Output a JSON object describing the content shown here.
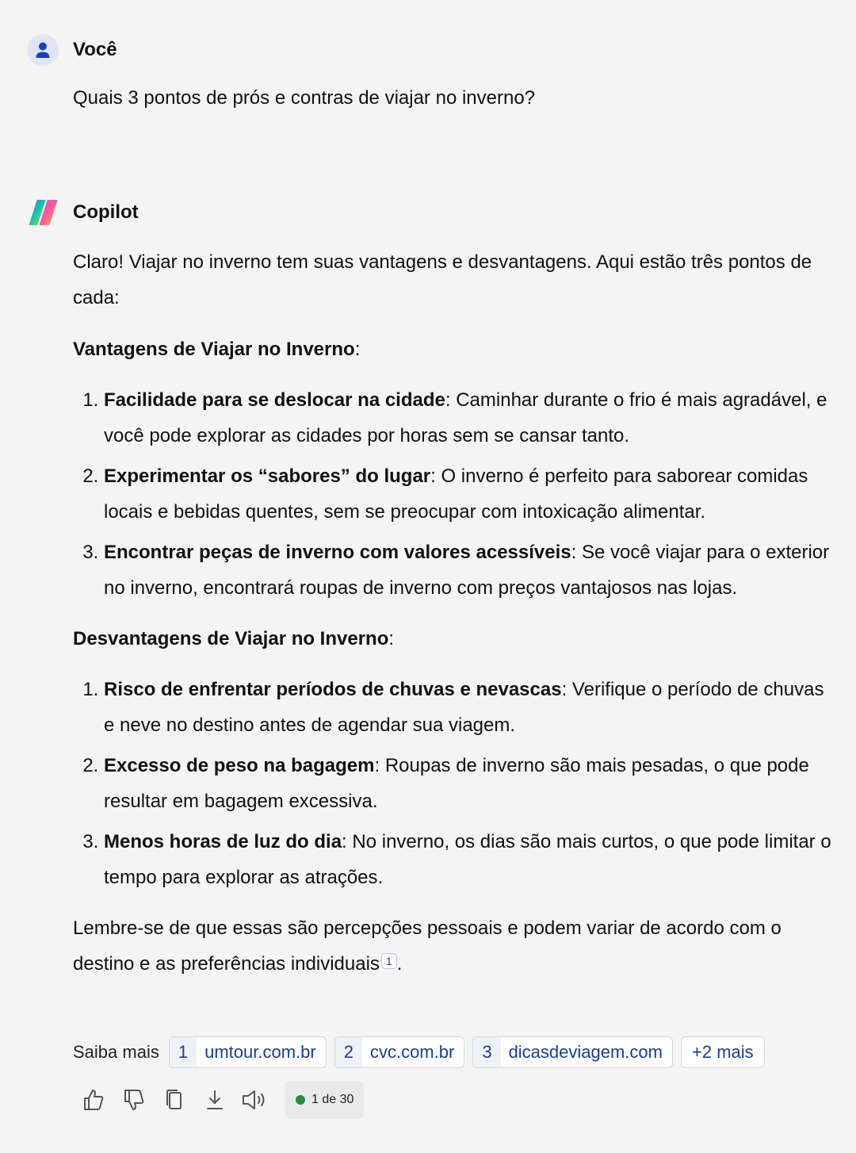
{
  "user_message": {
    "sender": "Você",
    "text": "Quais 3 pontos de prós e contras de viajar no inverno?"
  },
  "assistant_message": {
    "sender": "Copilot",
    "intro": "Claro! Viajar no inverno tem suas vantagens e desvantagens. Aqui estão três pontos de cada:",
    "advantages": {
      "title": "Vantagens de Viajar no Inverno",
      "items": [
        {
          "bold": "Facilidade para se deslocar na cidade",
          "text": ": Caminhar durante o frio é mais agradável, e você pode explorar as cidades por horas sem se cansar tanto."
        },
        {
          "bold": "Experimentar os “sabores” do lugar",
          "text": ": O inverno é perfeito para saborear comidas locais e bebidas quentes, sem se preocupar com intoxicação alimentar."
        },
        {
          "bold": "Encontrar peças de inverno com valores acessíveis",
          "text": ": Se você viajar para o exterior no inverno, encontrará roupas de inverno com preços vantajosos nas lojas."
        }
      ]
    },
    "disadvantages": {
      "title": "Desvantagens de Viajar no Inverno",
      "items": [
        {
          "bold": "Risco de enfrentar períodos de chuvas e nevascas",
          "text": ": Verifique o período de chuvas e neve no destino antes de agendar sua viagem."
        },
        {
          "bold": "Excesso de peso na bagagem",
          "text": ": Roupas de inverno são mais pesadas, o que pode resultar em bagagem excessiva."
        },
        {
          "bold": "Menos horas de luz do dia",
          "text": ": No inverno, os dias são mais curtos, o que pode limitar o tempo para explorar as atrações."
        }
      ]
    },
    "conclusion": "Lembre-se de que essas são percepções pessoais e podem variar de acordo com o destino e as preferências individuais",
    "conclusion_end": ".",
    "citation": "1"
  },
  "learn_more": {
    "label": "Saiba mais",
    "sources": [
      {
        "num": "1",
        "domain": "umtour.com.br"
      },
      {
        "num": "2",
        "domain": "cvc.com.br"
      },
      {
        "num": "3",
        "domain": "dicasdeviagem.com"
      }
    ],
    "more_label": "+2 mais"
  },
  "actions": {
    "icons": [
      "thumbs-up-icon",
      "thumbs-down-icon",
      "copy-icon",
      "download-icon",
      "speaker-icon"
    ],
    "counter": "1 de 30",
    "counter_dot_color": "#2a8a3e"
  },
  "colors": {
    "background": "#f4f4f4",
    "link": "#1a3d8f",
    "user_avatar_bg": "#dfe4f7",
    "user_avatar_fg": "#1f3fae"
  }
}
